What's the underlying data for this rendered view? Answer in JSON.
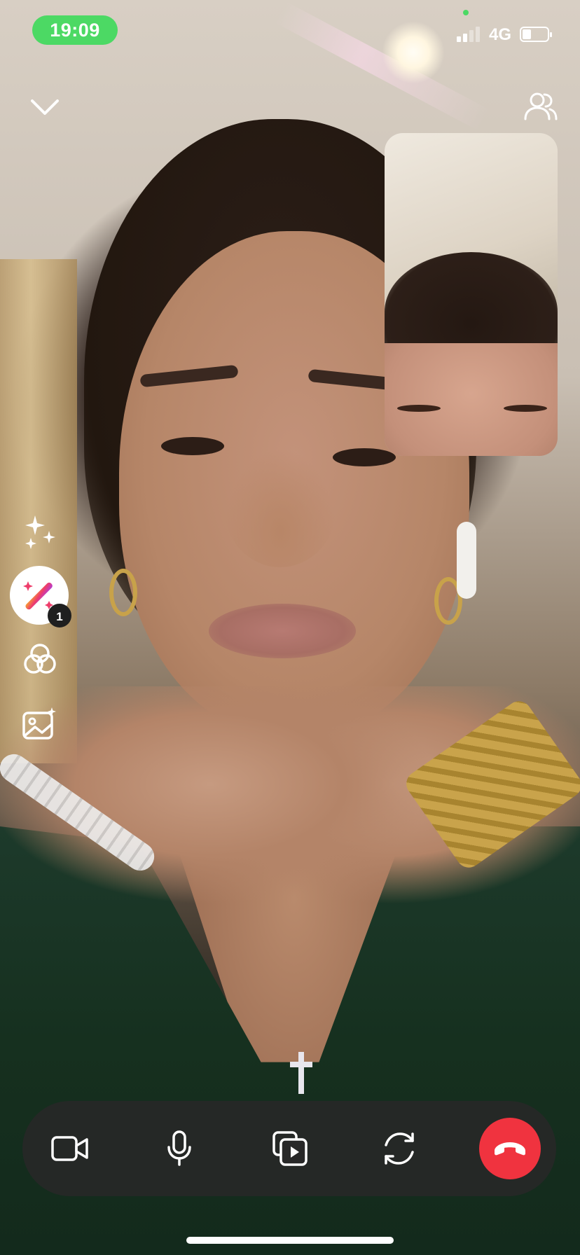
{
  "status_bar": {
    "time": "19:09",
    "network": "4G",
    "signal_bars_active": 2,
    "signal_bars_total": 4,
    "battery_level": 0.35
  },
  "header": {
    "collapse_icon": "chevron-down-icon",
    "participants_icon": "people-icon"
  },
  "effects_rail": {
    "items": [
      {
        "name": "sparkles-icon"
      },
      {
        "name": "magic-wand-icon",
        "badge": "1"
      },
      {
        "name": "filters-icon"
      },
      {
        "name": "background-image-icon"
      }
    ]
  },
  "controls": {
    "items": [
      {
        "name": "video-camera-icon"
      },
      {
        "name": "microphone-icon"
      },
      {
        "name": "media-share-icon"
      },
      {
        "name": "flip-camera-icon"
      },
      {
        "name": "end-call-icon"
      }
    ]
  },
  "colors": {
    "time_pill": "#4cd964",
    "end_call": "#f0333f",
    "control_bar": "#282828"
  }
}
